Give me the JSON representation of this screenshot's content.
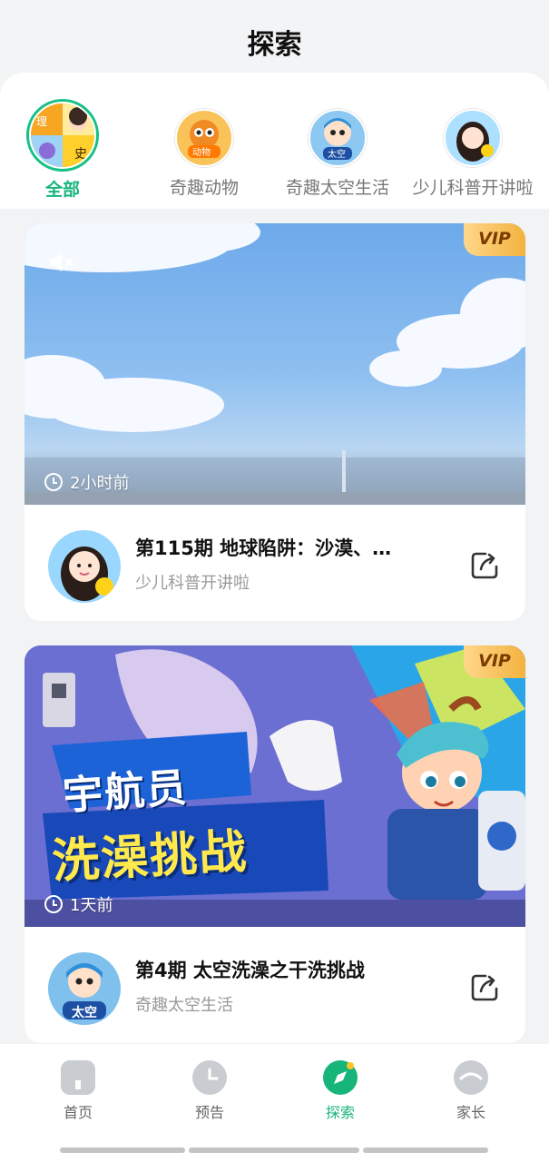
{
  "header": {
    "title": "探索"
  },
  "categories": [
    {
      "label": "全部",
      "active": true,
      "icon": "mosaic-avatar-icon"
    },
    {
      "label": "奇趣动物",
      "active": false,
      "icon": "animal-mascot-icon",
      "badge": "动物"
    },
    {
      "label": "奇趣太空生活",
      "active": false,
      "icon": "astronaut-mascot-icon",
      "badge": "太空"
    },
    {
      "label": "少儿科普开讲啦",
      "active": false,
      "icon": "host-girl-avatar-icon"
    }
  ],
  "cards": [
    {
      "vip": "VIP",
      "time": "2小时前",
      "title": "第115期 地球陷阱：沙漠、…",
      "channel": "少儿科普开讲啦"
    },
    {
      "vip": "VIP",
      "time": "1天前",
      "cover_text_1": "宇航员",
      "cover_text_2": "洗澡挑战",
      "channel_badge": "太空",
      "title": "第4期 太空洗澡之干洗挑战",
      "channel": "奇趣太空生活"
    }
  ],
  "tabbar": [
    {
      "label": "首页",
      "active": false
    },
    {
      "label": "预告",
      "active": false
    },
    {
      "label": "探索",
      "active": true
    },
    {
      "label": "家长",
      "active": false
    }
  ],
  "colors": {
    "accent": "#16b57c",
    "vip": "#f3b23f",
    "sky": "#79b3ec"
  }
}
